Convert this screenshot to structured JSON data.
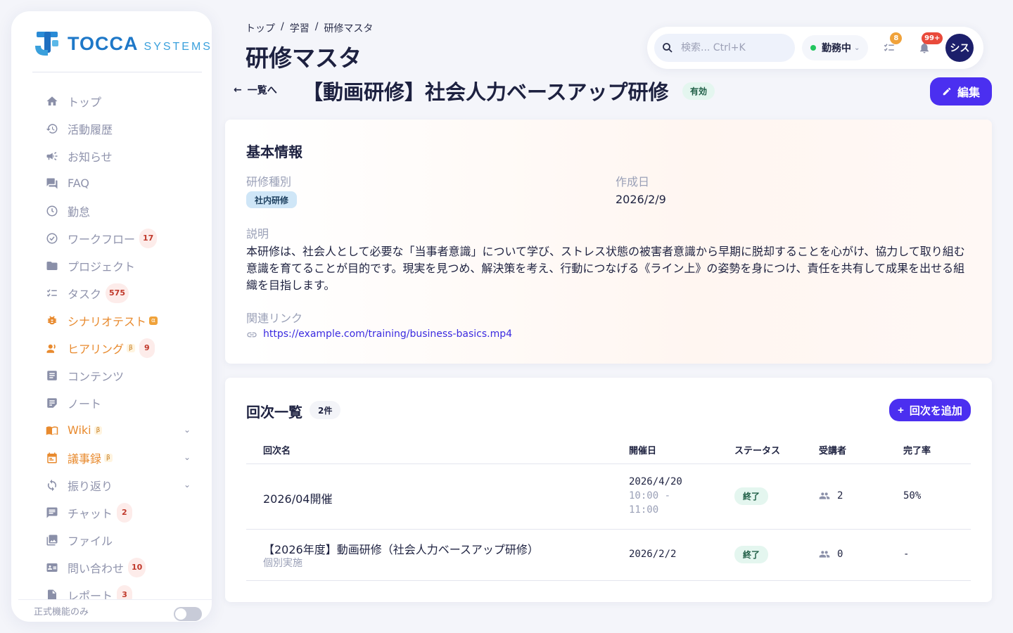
{
  "app": {
    "brand_main": "TOCCA",
    "brand_sub": "SYSTEMS"
  },
  "sidebar": {
    "items": [
      {
        "label": "トップ",
        "icon": "home-icon"
      },
      {
        "label": "活動履歴",
        "icon": "history-icon"
      },
      {
        "label": "お知らせ",
        "icon": "megaphone-icon"
      },
      {
        "label": "FAQ",
        "icon": "forum-icon"
      },
      {
        "label": "勤怠",
        "icon": "clock-icon"
      },
      {
        "label": "ワークフロー",
        "icon": "check-circle-icon",
        "badge": "17"
      },
      {
        "label": "プロジェクト",
        "icon": "folder-icon"
      },
      {
        "label": "タスク",
        "icon": "checklist-icon",
        "badge": "575"
      },
      {
        "label": "シナリオテスト",
        "icon": "bug-icon",
        "tag": "α"
      },
      {
        "label": "ヒアリング",
        "icon": "person-voice-icon",
        "tag": "β",
        "badge": "9"
      },
      {
        "label": "コンテンツ",
        "icon": "article-icon"
      },
      {
        "label": "ノート",
        "icon": "note-icon"
      },
      {
        "label": "Wiki",
        "icon": "book-icon",
        "tag": "β"
      },
      {
        "label": "議事録",
        "icon": "calendar-icon",
        "tag": "β"
      },
      {
        "label": "振り返り",
        "icon": "refresh-icon"
      },
      {
        "label": "チャット",
        "icon": "chat-icon",
        "badge": "2"
      },
      {
        "label": "ファイル",
        "icon": "image-icon"
      },
      {
        "label": "問い合わせ",
        "icon": "contact-card-icon",
        "badge": "10"
      },
      {
        "label": "レポート",
        "icon": "report-icon",
        "badge": "3"
      }
    ],
    "footer_label": "正式機能のみ"
  },
  "header": {
    "breadcrumb": [
      "トップ",
      "学習",
      "研修マスタ"
    ],
    "title": "研修マスタ",
    "search_placeholder": "検索... Ctrl+K",
    "work_status": "勤務中",
    "task_badge": "8",
    "notif_badge": "99+",
    "avatar": "シス"
  },
  "detail": {
    "back_label": "一覧へ",
    "title": "【動画研修】社会人力ベースアップ研修",
    "status": "有効",
    "edit_label": "編集"
  },
  "basic": {
    "heading": "基本情報",
    "type_label": "研修種別",
    "type_value": "社内研修",
    "created_label": "作成日",
    "created_value": "2026/2/9",
    "desc_label": "説明",
    "desc_value": "本研修は、社会人として必要な「当事者意識」について学び、ストレス状態の被害者意識から早期に脱却することを心がけ、協力して取り組む意識を育てることが目的です。現実を見つめ、解決策を考え、行動につなげる《ライン上》の姿勢を身につけ、責任を共有して成果を出せる組織を目指します。",
    "link_label": "関連リンク",
    "link_value": "https://example.com/training/business-basics.mp4"
  },
  "sessions": {
    "heading": "回次一覧",
    "count": "2件",
    "add_label": "回次を追加",
    "columns": [
      "回次名",
      "開催日",
      "ステータス",
      "受講者",
      "完了率"
    ],
    "rows": [
      {
        "name": "2026/04開催",
        "sub": "",
        "date": "2026/4/20",
        "time1": "10:00 -",
        "time2": "11:00",
        "status": "終了",
        "attendees": "2",
        "completion": "50%"
      },
      {
        "name": "【2026年度】動画研修（社会人力ベースアップ研修）",
        "sub": "個別実施",
        "date": "2026/2/2",
        "time1": "",
        "time2": "",
        "status": "終了",
        "attendees": "0",
        "completion": "-"
      }
    ]
  },
  "colors": {
    "accent": "#4b2ff0",
    "brand": "#1e78c8",
    "orange": "#e88a2e",
    "avatar": "#1c1f6b"
  }
}
